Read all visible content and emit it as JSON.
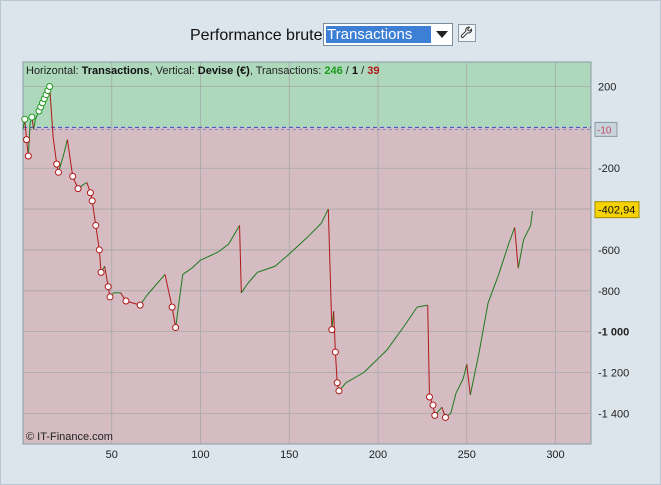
{
  "header": {
    "label": "Performance brute",
    "metric_select_value": "Transactions"
  },
  "chart_data": {
    "type": "line",
    "title_prefix_h": "Horizontal: ",
    "title_h_value": "Transactions",
    "title_prefix_v": ", Vertical: ",
    "title_v_value": "Devise (€)",
    "title_tx_label": ", Transactions: ",
    "tx_green": "246",
    "tx_sep1": " / ",
    "tx_black": "1",
    "tx_sep2": " / ",
    "tx_red": "39",
    "xlim": [
      0,
      320
    ],
    "ylim": [
      -1550,
      320
    ],
    "x_ticks": [
      {
        "value": 50,
        "label": "50"
      },
      {
        "value": 100,
        "label": "100"
      },
      {
        "value": 150,
        "label": "150"
      },
      {
        "value": 200,
        "label": "200"
      },
      {
        "value": 250,
        "label": "250"
      },
      {
        "value": 300,
        "label": "300"
      }
    ],
    "y_ticks": [
      {
        "value": 200,
        "label": "200",
        "bold": false
      },
      {
        "value": -200,
        "label": "-200",
        "bold": false
      },
      {
        "value": -400,
        "label": "-400",
        "bold": false
      },
      {
        "value": -600,
        "label": "-600",
        "bold": false
      },
      {
        "value": -800,
        "label": "-800",
        "bold": false
      },
      {
        "value": -1000,
        "label": "-1 000",
        "bold": true
      },
      {
        "value": -1200,
        "label": "-1 200",
        "bold": false
      },
      {
        "value": -1400,
        "label": "-1 400",
        "bold": false
      }
    ],
    "zero_line": 0,
    "marker_ref": {
      "value": -10,
      "label": "-10"
    },
    "marker_last": {
      "value": -402.94,
      "label": "-402,94"
    },
    "copyright": "© IT-Finance.com",
    "colors": {
      "profit_zone": "#aed8bb",
      "loss_zone": "#d4bcc2",
      "up_line": "#1e7a1e",
      "down_line": "#b01818",
      "win_marker": "#1e9a1e",
      "loss_marker": "#b01818",
      "last_badge": "#f5d200"
    },
    "series_points": [
      [
        0,
        -10
      ],
      [
        1,
        40
      ],
      [
        2,
        -60
      ],
      [
        3,
        -140
      ],
      [
        4,
        20
      ],
      [
        5,
        50
      ],
      [
        6,
        -10
      ],
      [
        7,
        40
      ],
      [
        8,
        60
      ],
      [
        9,
        80
      ],
      [
        10,
        100
      ],
      [
        11,
        120
      ],
      [
        12,
        140
      ],
      [
        13,
        160
      ],
      [
        14,
        180
      ],
      [
        15,
        200
      ],
      [
        17,
        -50
      ],
      [
        19,
        -180
      ],
      [
        20,
        -220
      ],
      [
        23,
        -130
      ],
      [
        25,
        -60
      ],
      [
        28,
        -240
      ],
      [
        31,
        -300
      ],
      [
        34,
        -280
      ],
      [
        36,
        -270
      ],
      [
        38,
        -320
      ],
      [
        39,
        -360
      ],
      [
        41,
        -480
      ],
      [
        43,
        -600
      ],
      [
        44,
        -710
      ],
      [
        46,
        -680
      ],
      [
        48,
        -780
      ],
      [
        49,
        -830
      ],
      [
        51,
        -810
      ],
      [
        55,
        -810
      ],
      [
        58,
        -850
      ],
      [
        66,
        -870
      ],
      [
        70,
        -820
      ],
      [
        80,
        -720
      ],
      [
        84,
        -880
      ],
      [
        86,
        -980
      ],
      [
        90,
        -720
      ],
      [
        95,
        -690
      ],
      [
        100,
        -650
      ],
      [
        110,
        -610
      ],
      [
        116,
        -570
      ],
      [
        122,
        -480
      ],
      [
        123,
        -810
      ],
      [
        127,
        -760
      ],
      [
        132,
        -710
      ],
      [
        142,
        -680
      ],
      [
        150,
        -620
      ],
      [
        160,
        -540
      ],
      [
        168,
        -470
      ],
      [
        172,
        -400
      ],
      [
        174,
        -990
      ],
      [
        175,
        -900
      ],
      [
        176,
        -1100
      ],
      [
        177,
        -1250
      ],
      [
        178,
        -1290
      ],
      [
        182,
        -1250
      ],
      [
        192,
        -1200
      ],
      [
        205,
        -1090
      ],
      [
        215,
        -970
      ],
      [
        222,
        -880
      ],
      [
        228,
        -870
      ],
      [
        229,
        -1320
      ],
      [
        231,
        -1360
      ],
      [
        232,
        -1410
      ],
      [
        236,
        -1370
      ],
      [
        238,
        -1420
      ],
      [
        241,
        -1400
      ],
      [
        244,
        -1300
      ],
      [
        248,
        -1230
      ],
      [
        250,
        -1160
      ],
      [
        252,
        -1310
      ],
      [
        257,
        -1100
      ],
      [
        262,
        -860
      ],
      [
        268,
        -720
      ],
      [
        274,
        -560
      ],
      [
        277,
        -490
      ],
      [
        279,
        -690
      ],
      [
        282,
        -550
      ],
      [
        286,
        -480
      ],
      [
        287,
        -410
      ]
    ],
    "win_markers": [
      [
        1,
        40
      ],
      [
        5,
        50
      ],
      [
        9,
        80
      ],
      [
        10,
        100
      ],
      [
        11,
        120
      ],
      [
        12,
        140
      ],
      [
        13,
        160
      ],
      [
        14,
        180
      ],
      [
        15,
        200
      ]
    ],
    "loss_markers": [
      [
        2,
        -60
      ],
      [
        3,
        -140
      ],
      [
        19,
        -180
      ],
      [
        20,
        -220
      ],
      [
        28,
        -240
      ],
      [
        31,
        -300
      ],
      [
        38,
        -320
      ],
      [
        39,
        -360
      ],
      [
        41,
        -480
      ],
      [
        43,
        -600
      ],
      [
        44,
        -710
      ],
      [
        48,
        -780
      ],
      [
        49,
        -830
      ],
      [
        58,
        -850
      ],
      [
        66,
        -870
      ],
      [
        84,
        -880
      ],
      [
        86,
        -980
      ],
      [
        174,
        -990
      ],
      [
        176,
        -1100
      ],
      [
        177,
        -1250
      ],
      [
        178,
        -1290
      ],
      [
        229,
        -1320
      ],
      [
        231,
        -1360
      ],
      [
        232,
        -1410
      ],
      [
        238,
        -1420
      ]
    ]
  }
}
